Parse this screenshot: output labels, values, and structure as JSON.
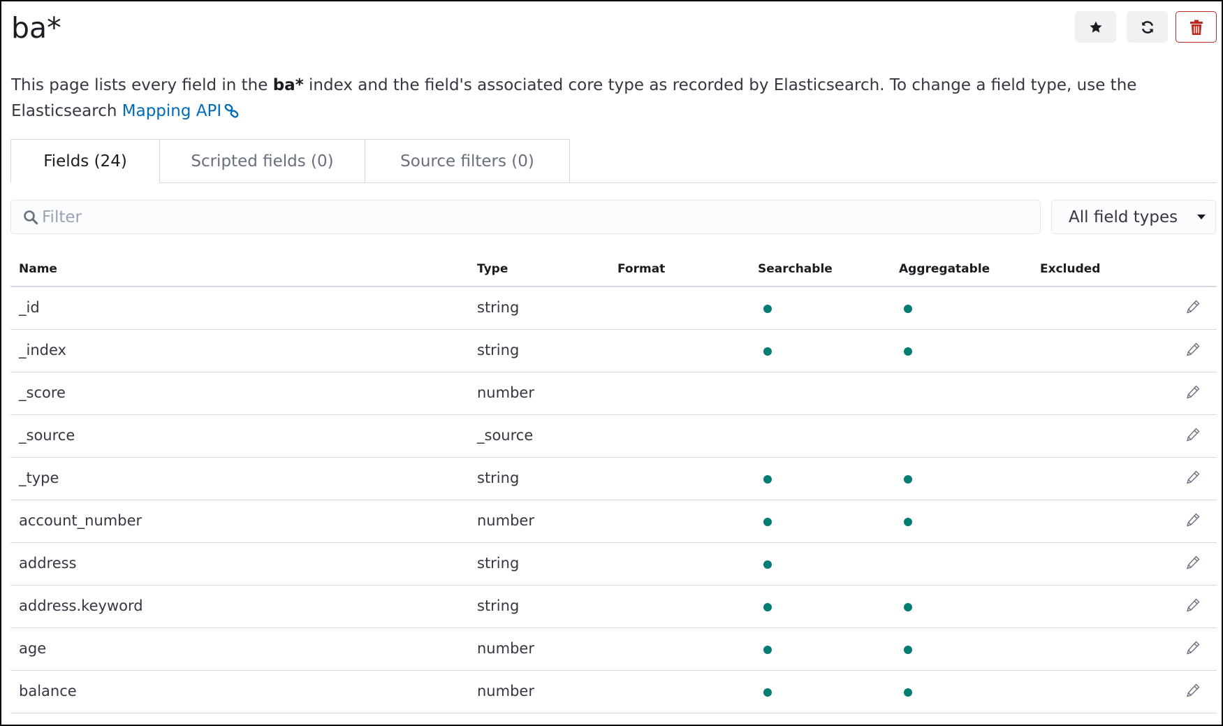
{
  "header": {
    "title": "ba*",
    "buttons": {
      "favorite_icon": "star-icon",
      "refresh_icon": "refresh-icon",
      "delete_icon": "trash-icon"
    }
  },
  "description": {
    "before": "This page lists every field in the ",
    "index": "ba*",
    "after": " index and the field's associated core type as recorded by Elasticsearch. To change a field type, use the Elasticsearch ",
    "link": "Mapping API"
  },
  "tabs": [
    {
      "label": "Fields (24)",
      "active": true
    },
    {
      "label": "Scripted fields (0)",
      "active": false
    },
    {
      "label": "Source filters (0)",
      "active": false
    }
  ],
  "filter": {
    "placeholder": "Filter",
    "type_select": "All field types"
  },
  "table": {
    "columns": [
      "Name",
      "Type",
      "Format",
      "Searchable",
      "Aggregatable",
      "Excluded"
    ],
    "rows": [
      {
        "name": "_id",
        "type": "string",
        "searchable": true,
        "aggregatable": true
      },
      {
        "name": "_index",
        "type": "string",
        "searchable": true,
        "aggregatable": true
      },
      {
        "name": "_score",
        "type": "number",
        "searchable": false,
        "aggregatable": false
      },
      {
        "name": "_source",
        "type": "_source",
        "searchable": false,
        "aggregatable": false
      },
      {
        "name": "_type",
        "type": "string",
        "searchable": true,
        "aggregatable": true
      },
      {
        "name": "account_number",
        "type": "number",
        "searchable": true,
        "aggregatable": true
      },
      {
        "name": "address",
        "type": "string",
        "searchable": true,
        "aggregatable": false
      },
      {
        "name": "address.keyword",
        "type": "string",
        "searchable": true,
        "aggregatable": true
      },
      {
        "name": "age",
        "type": "number",
        "searchable": true,
        "aggregatable": true
      },
      {
        "name": "balance",
        "type": "number",
        "searchable": true,
        "aggregatable": true
      }
    ]
  },
  "colors": {
    "indicator": "#017d73",
    "link": "#006bb8",
    "danger": "#bd271e"
  }
}
